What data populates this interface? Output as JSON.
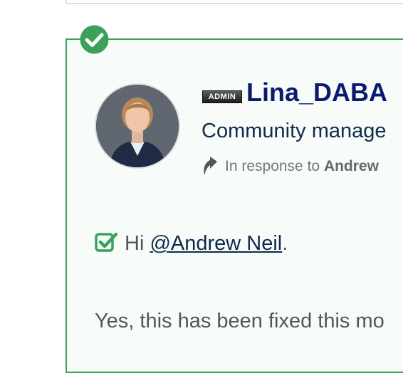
{
  "post": {
    "rank_badge": "ADMIN",
    "username": "Lina_DABA",
    "role": "Community manage",
    "in_response_prefix": "In response to",
    "in_response_user": "Andrew",
    "greeting_prefix": "Hi",
    "mention": "@Andrew Neil",
    "greeting_suffix": ".",
    "body_line": "Yes, this has been fixed this mo"
  },
  "colors": {
    "solved_green": "#3aa05a",
    "username_navy": "#0b1a6e",
    "post_background": "#f7fcf9"
  },
  "icons": [
    "solved-check-icon",
    "reply-arrow-icon",
    "checkbox-check-icon"
  ]
}
